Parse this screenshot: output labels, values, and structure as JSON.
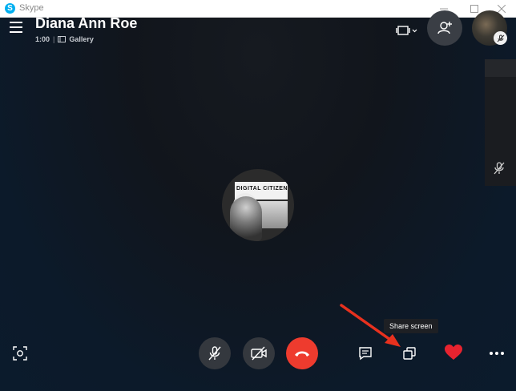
{
  "window": {
    "title": "Skype",
    "logo_letter": "S"
  },
  "call": {
    "name": "Diana Ann Roe",
    "duration": "1:00",
    "view_mode": "Gallery"
  },
  "center_avatar": {
    "banner_text": "DIGITAL CITIZEN"
  },
  "tooltip": {
    "share_screen": "Share screen"
  },
  "colors": {
    "end_call": "#ee3b2e",
    "heart": "#e8232f",
    "arrow": "#e8311e",
    "skype_blue": "#00aff0"
  },
  "icons": {
    "menu": "hamburger-icon",
    "layout": "layout-switch-icon",
    "add_participant": "add-person-icon",
    "mic_muted": "mic-off-icon",
    "video_off": "video-off-icon",
    "end_call": "phone-hangup-icon",
    "chat": "chat-icon",
    "share_screen": "share-screen-icon",
    "react": "heart-icon",
    "more": "more-options-icon",
    "snapshot": "camera-snapshot-icon"
  }
}
